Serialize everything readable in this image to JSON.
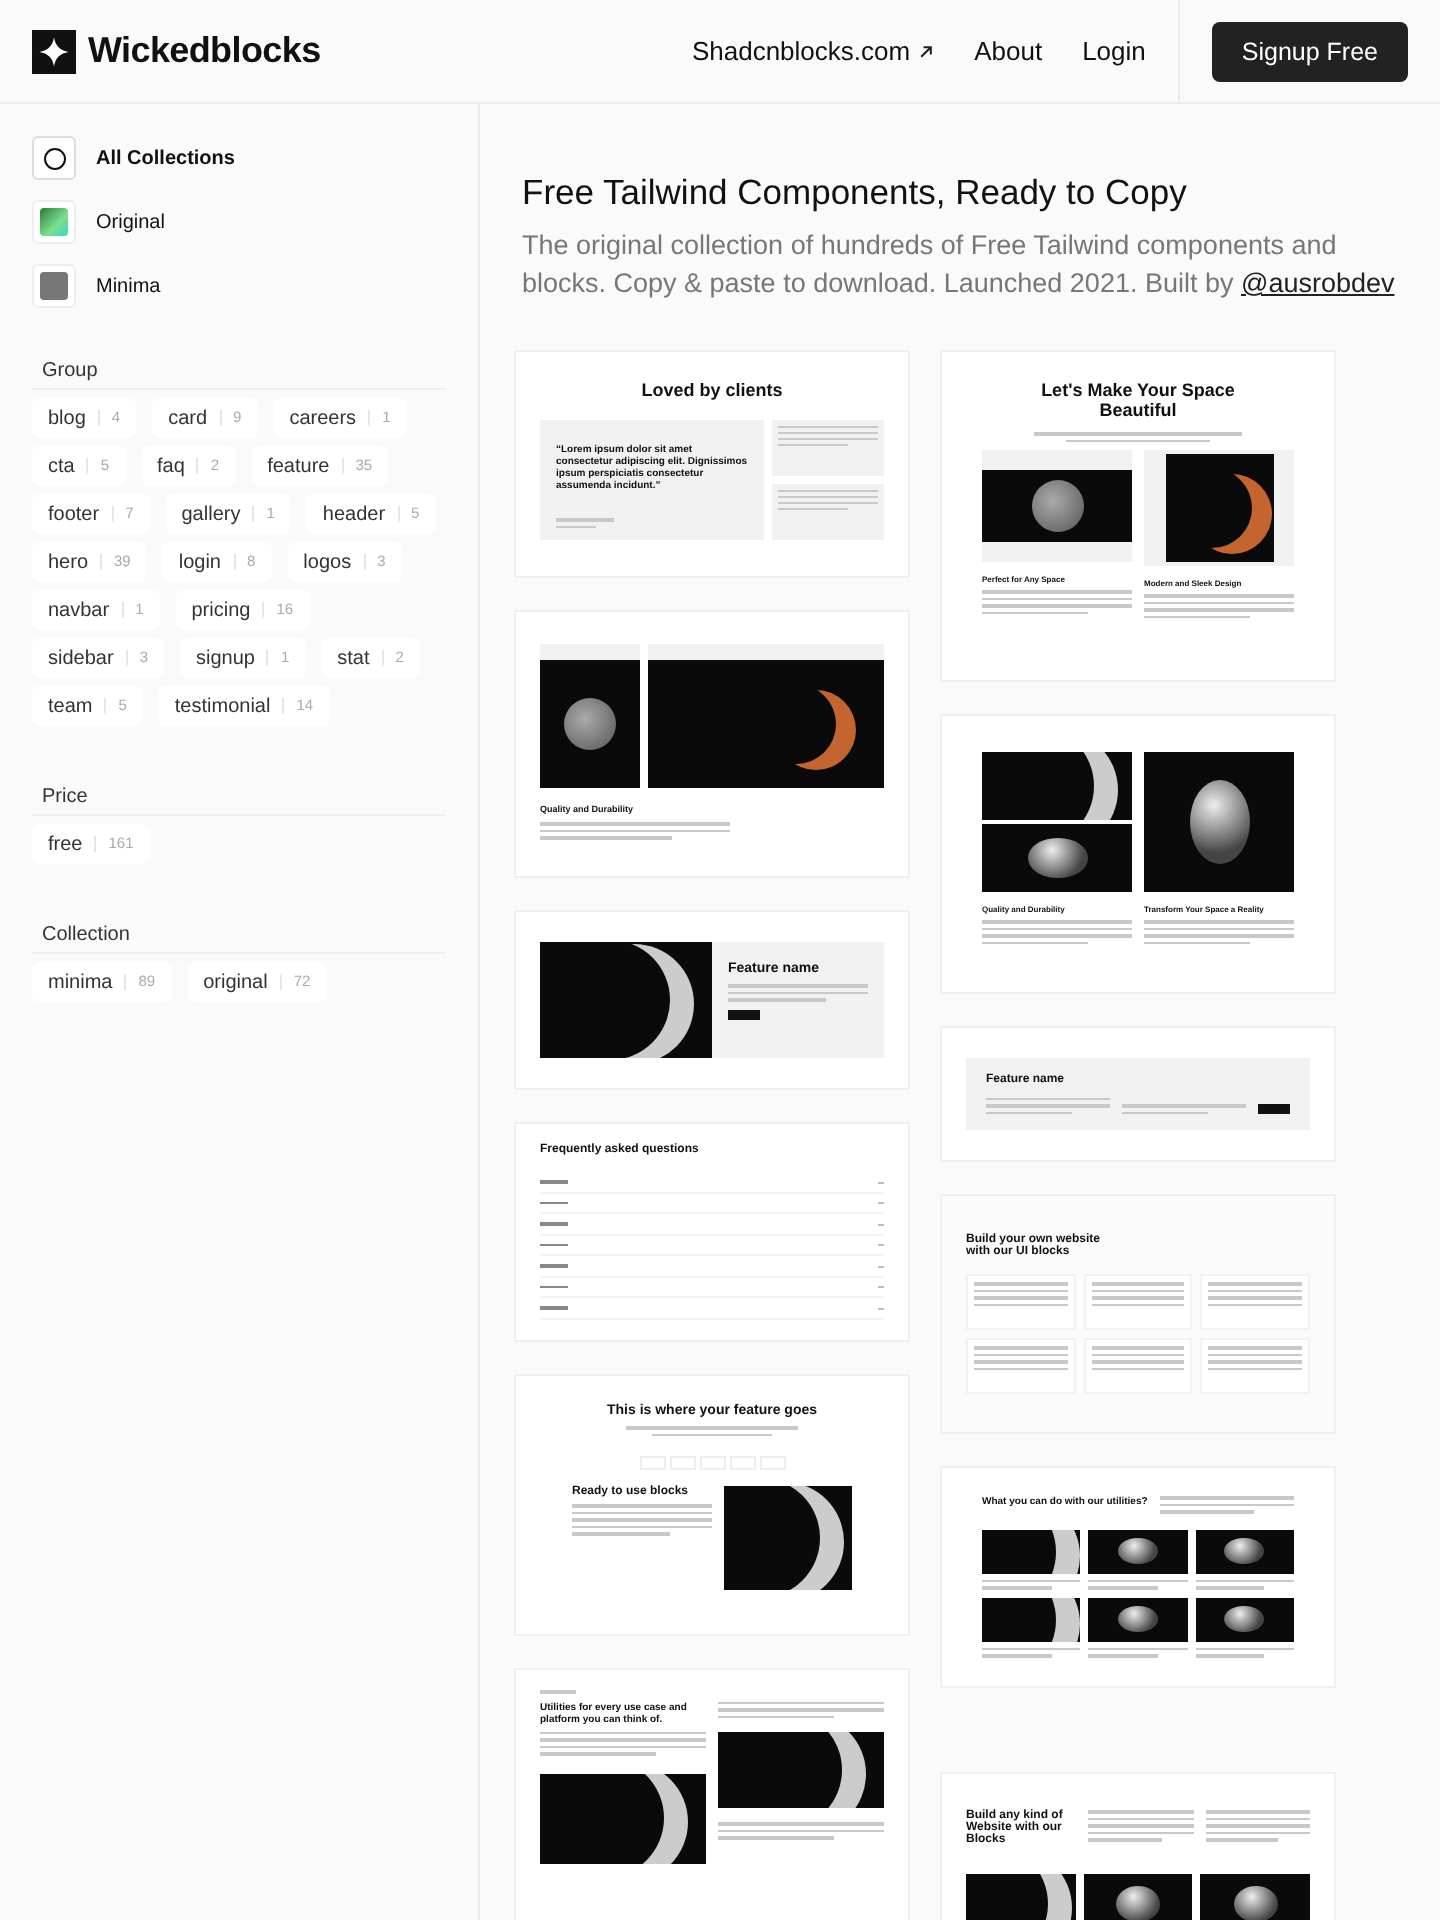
{
  "header": {
    "brand": "Wickedblocks",
    "nav": [
      {
        "label": "Shadcnblocks.com",
        "external": true
      },
      {
        "label": "About",
        "external": false
      },
      {
        "label": "Login",
        "external": false
      }
    ],
    "cta": "Signup Free"
  },
  "sidebar": {
    "collections": [
      {
        "label": "All Collections",
        "kind": "all",
        "selected": true
      },
      {
        "label": "Original",
        "kind": "gradient",
        "selected": false
      },
      {
        "label": "Minima",
        "kind": "grey",
        "selected": false
      }
    ],
    "sections": [
      {
        "title": "Group",
        "tags": [
          {
            "label": "blog",
            "count": "4"
          },
          {
            "label": "card",
            "count": "9"
          },
          {
            "label": "careers",
            "count": "1"
          },
          {
            "label": "cta",
            "count": "5"
          },
          {
            "label": "faq",
            "count": "2"
          },
          {
            "label": "feature",
            "count": "35"
          },
          {
            "label": "footer",
            "count": "7"
          },
          {
            "label": "gallery",
            "count": "1"
          },
          {
            "label": "header",
            "count": "5"
          },
          {
            "label": "hero",
            "count": "39"
          },
          {
            "label": "login",
            "count": "8"
          },
          {
            "label": "logos",
            "count": "3"
          },
          {
            "label": "navbar",
            "count": "1"
          },
          {
            "label": "pricing",
            "count": "16"
          },
          {
            "label": "sidebar",
            "count": "3"
          },
          {
            "label": "signup",
            "count": "1"
          },
          {
            "label": "stat",
            "count": "2"
          },
          {
            "label": "team",
            "count": "5"
          },
          {
            "label": "testimonial",
            "count": "14"
          }
        ]
      },
      {
        "title": "Price",
        "tags": [
          {
            "label": "free",
            "count": "161"
          }
        ]
      },
      {
        "title": "Collection",
        "tags": [
          {
            "label": "minima",
            "count": "89"
          },
          {
            "label": "original",
            "count": "72"
          }
        ]
      }
    ]
  },
  "main": {
    "title": "Free Tailwind Components, Ready to Copy",
    "subtitle": "The original collection of hundreds of Free Tailwind components and blocks. Copy & paste to download. Launched 2021. Built by",
    "author_link": "@ausrobdev",
    "columns": [
      [
        {
          "kind": "testimonial",
          "title": "Loved by clients",
          "texts": [
            "“Lorem ipsum dolor sit amet consectetur adipiscing elit. Dignissimos ipsum perspiciatis consectetur assumenda incidunt.”"
          ]
        },
        {
          "kind": "gallery",
          "title": "Quality and Durability"
        },
        {
          "kind": "feature-split",
          "title": "Feature name"
        },
        {
          "kind": "faq",
          "title": "Frequently asked questions"
        },
        {
          "kind": "feature-tabs",
          "title": "This is where your feature goes",
          "texts": [
            "Ready to use blocks"
          ]
        },
        {
          "kind": "utilities",
          "title": "Utilities for every use case and platform you can think of."
        }
      ],
      [
        {
          "kind": "hero-gallery",
          "title": "Let's Make Your Space Beautiful",
          "texts": [
            "Perfect for Any Space",
            "Modern and Sleek Design"
          ]
        },
        {
          "kind": "gallery-grid",
          "texts": [
            "Quality and Durability",
            "Transform Your Space a Reality"
          ]
        },
        {
          "kind": "feature-list",
          "title": "Feature name"
        },
        {
          "kind": "ui-blocks",
          "title": "Build your own website with our UI blocks"
        },
        {
          "kind": "utilities-grid",
          "title": "What you can do with our utilities?"
        },
        {
          "kind": "build-any",
          "title": "Build any kind of Website with our Blocks"
        }
      ]
    ]
  }
}
